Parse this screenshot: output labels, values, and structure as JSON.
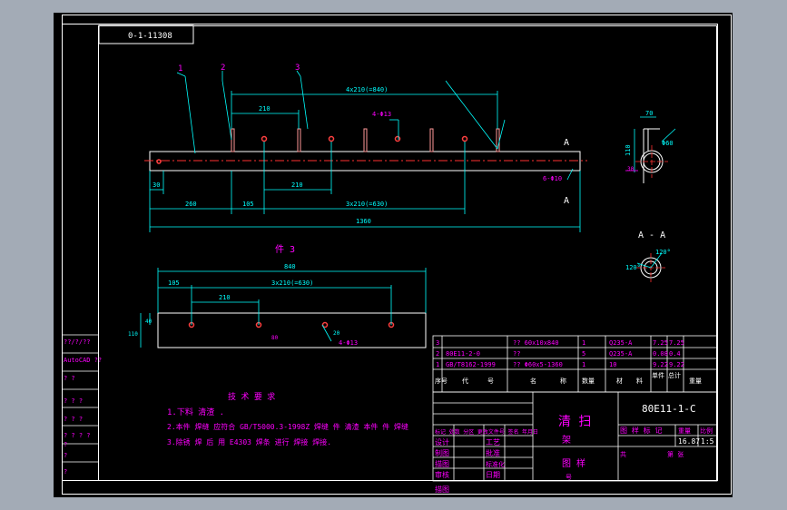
{
  "drawing_code": "0-1-11308",
  "balloons": [
    "1",
    "2",
    "3"
  ],
  "section_marker": "A",
  "section_title": "A - A",
  "part3_title": "件 3",
  "front_view": {
    "dims": [
      "4x210(=840)",
      "210",
      "4-Φ13",
      "30",
      "260",
      "105",
      "210",
      "3x210(=630)",
      "1360",
      "6-Φ10"
    ],
    "side_dims": [
      "110",
      "70",
      "Φ60",
      "30"
    ]
  },
  "section_view": {
    "dims": [
      "120°",
      "120°"
    ]
  },
  "part3_view": {
    "dims": [
      "840",
      "105",
      "3x210(=630)",
      "210",
      "40",
      "110",
      "80",
      "20",
      "4-Φ13"
    ]
  },
  "left_strip": [
    "??/?/??",
    "AutoCAD ??",
    "? ?",
    "? ? ?",
    "? ? ?",
    "? ? ? ?",
    "?",
    "?",
    "?"
  ],
  "tech_req": {
    "title": "技 术 要 求",
    "lines": [
      "1.下料 清渣 .",
      "2.本件 焊缝 应符合 GB/T5000.3-1998Z 焊缝 件 清渣 本件 件 焊缝",
      "3.除锈 焊 后 用 E4303 焊条 进行 焊接 焊接."
    ]
  },
  "bom": {
    "rows": [
      [
        "3",
        "",
        "?? 60x10x840",
        "1",
        "Q235-A",
        "7.25",
        "7.25"
      ],
      [
        "2",
        "80E11-2-0",
        "??",
        "5",
        "Q235-A",
        "0.08",
        "0.4"
      ],
      [
        "1",
        "GB/T8162-1999",
        "?? Φ60x5-1360",
        "1",
        "10",
        "9.22",
        "9.22"
      ]
    ],
    "header": [
      "序号",
      "代",
      "号",
      "名",
      "称",
      "数量",
      "材",
      "料",
      "单件",
      "总计",
      "重量"
    ]
  },
  "title_block": {
    "part_name": "清 扫",
    "part_name2": "架",
    "drawing_no": "80E11-1-C",
    "stage_label": "图 样 标 记",
    "weight_label": "重量",
    "scale_label": "比例",
    "weight": "16.87",
    "scale": "1:5",
    "sheet_label": "共",
    "sheet_of_label": "第 张",
    "company": "图 样",
    "company2": "号",
    "rows": [
      "设计",
      "制图",
      "描图",
      "审核",
      "工艺",
      "批准",
      "标准化",
      "日期"
    ],
    "mark_row": "标记 处数 分区 更改文件号 签名 年月日",
    "bottom_label": "描图"
  },
  "colors": {
    "frame": "#ffffff",
    "outline": "#00ff00",
    "dim": "#00ffff",
    "center": "#ff3030",
    "text_magenta": "#ff00ff",
    "text_white": "#ffffff",
    "hole": "#ff4040",
    "slot": "#ff9999"
  }
}
